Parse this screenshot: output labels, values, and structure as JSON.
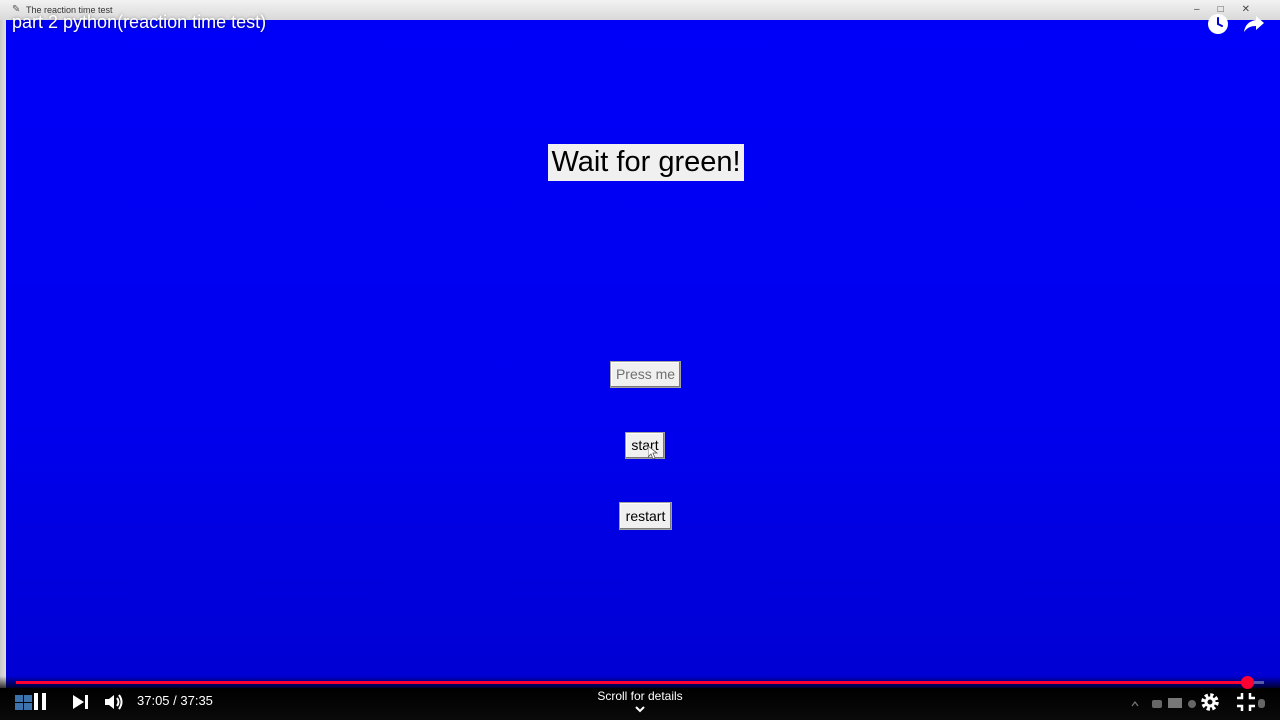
{
  "app_window": {
    "title": "The reaction time test",
    "background_color": "#0000f6",
    "instruction": "Wait for green!",
    "buttons": {
      "press": "Press me",
      "start": "start",
      "restart": "restart"
    }
  },
  "player": {
    "video_title": "part 2 python(reaction time test)",
    "time": "37:05 / 37:35",
    "scroll_hint": "Scroll for details",
    "progress_fraction": 0.986,
    "accent_color": "#ff0033",
    "icons": {
      "watch_later": "clock-icon",
      "share": "share-arrow-icon",
      "pause": "pause-icon",
      "next": "next-icon",
      "volume": "volume-icon",
      "settings": "gear-icon",
      "exit_fullscreen": "exit-fullscreen-icon",
      "scroll": "chevron-down-icon"
    }
  }
}
